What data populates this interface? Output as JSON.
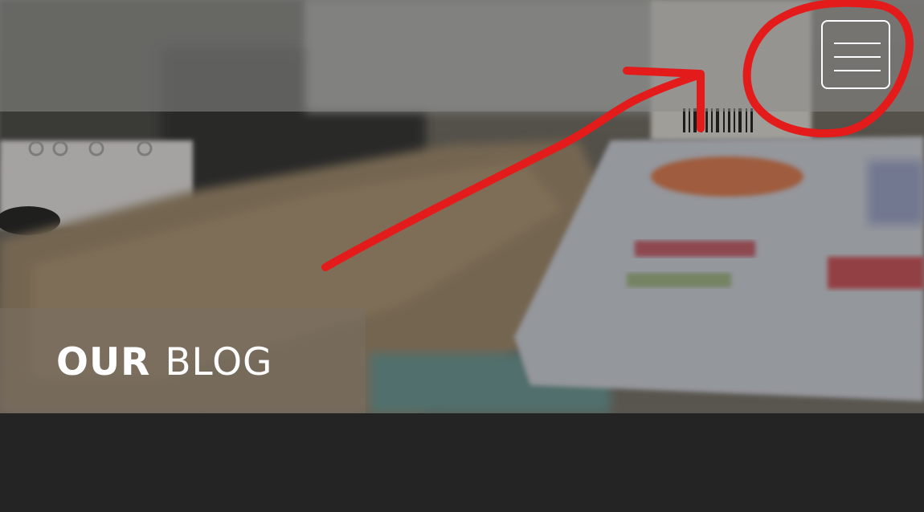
{
  "header": {
    "menu_icon": "hamburger-menu-icon"
  },
  "hero": {
    "title_strong": "OUR",
    "title_light": "BLOG"
  },
  "annotation": {
    "color": "#e41b1b",
    "shapes": [
      "circle",
      "arrow"
    ]
  }
}
